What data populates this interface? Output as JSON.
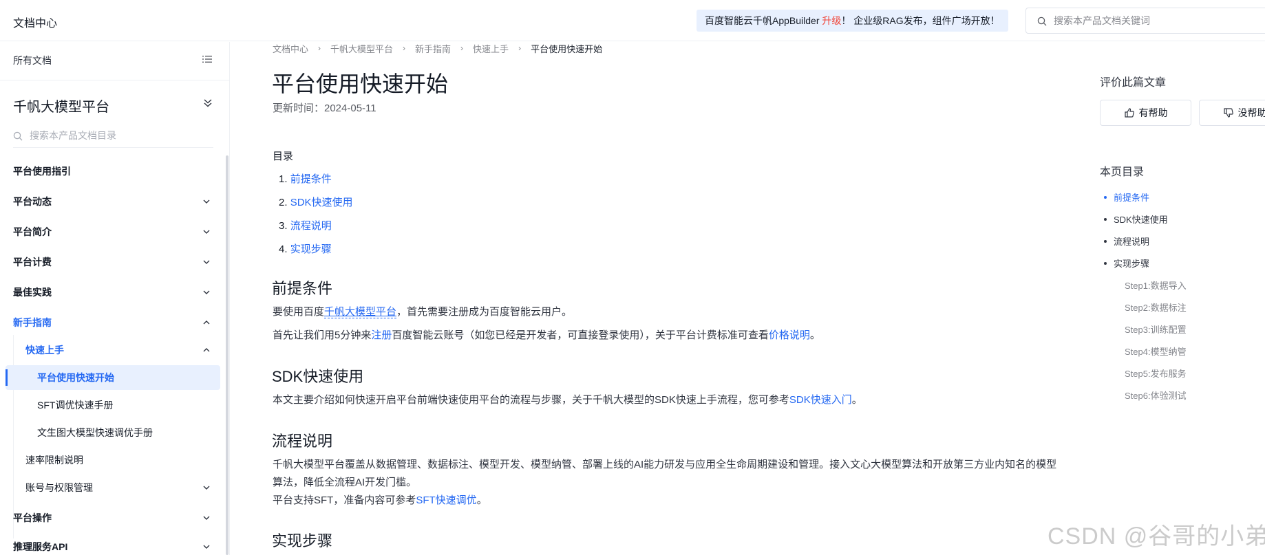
{
  "header": {
    "title": "文档中心",
    "banner": {
      "prefix": "百度智能云千帆AppBuilder ",
      "highlight": "升级",
      "suffix": "！ 企业级RAG发布，组件广场开放！"
    },
    "search_placeholder": "搜索本产品文档关键词"
  },
  "sidebar": {
    "all_docs": "所有文档",
    "product_title": "千帆大模型平台",
    "search_placeholder": "搜索本产品文档目录",
    "items": [
      {
        "label": "平台使用指引"
      },
      {
        "label": "平台动态"
      },
      {
        "label": "平台简介"
      },
      {
        "label": "平台计费"
      },
      {
        "label": "最佳实践"
      },
      {
        "label": "新手指南"
      },
      {
        "label": "快速上手"
      },
      {
        "label": "平台使用快速开始"
      },
      {
        "label": "SFT调优快速手册"
      },
      {
        "label": "文生图大模型快速调优手册"
      },
      {
        "label": "速率限制说明"
      },
      {
        "label": "账号与权限管理"
      },
      {
        "label": "平台操作"
      },
      {
        "label": "推理服务API"
      }
    ]
  },
  "breadcrumb": [
    "文档中心",
    "千帆大模型平台",
    "新手指南",
    "快速上手",
    "平台使用快速开始"
  ],
  "article": {
    "title": "平台使用快速开始",
    "updated": "更新时间：2024-05-11",
    "toc_label": "目录",
    "toc": [
      "前提条件",
      "SDK快速使用",
      "流程说明",
      "实现步骤"
    ],
    "sections": {
      "prereq": {
        "heading": "前提条件",
        "p1_before": "要使用百度",
        "p1_link": "千帆大模型平台",
        "p1_after": "，首先需要注册成为百度智能云用户。",
        "p2_before": "首先让我们用5分钟来",
        "p2_link": "注册",
        "p2_mid": "百度智能云账号（如您已经是开发者，可直接登录使用），关于平台计费标准可查看",
        "p2_link2": "价格说明",
        "p2_after": "。"
      },
      "sdk": {
        "heading": "SDK快速使用",
        "p_before": "本文主要介绍如何快速开启平台前端快速使用平台的流程与步骤，关于千帆大模型的SDK快速上手流程，您可参考",
        "p_link": "SDK快速入门",
        "p_after": "。"
      },
      "flow": {
        "heading": "流程说明",
        "p1": "千帆大模型平台覆盖从数据管理、数据标注、模型开发、模型纳管、部署上线的AI能力研发与应用全生命周期建设和管理。接入文心大模型算法和开放第三方业内知名的模型算法，降低全流程AI开发门槛。",
        "p2_before": "平台支持SFT，准备内容可参考",
        "p2_link": "SFT快速调优",
        "p2_after": "。"
      },
      "steps": {
        "heading": "实现步骤"
      }
    }
  },
  "rail": {
    "rate_title": "评价此篇文章",
    "helpful": "有帮助",
    "not_helpful": "没帮助",
    "page_toc_title": "本页目录",
    "page_toc": [
      "前提条件",
      "SDK快速使用",
      "流程说明",
      "实现步骤"
    ],
    "page_toc_sub": [
      "Step1:数据导入",
      "Step2:数据标注",
      "Step3:训练配置",
      "Step4:模型纳管",
      "Step5:发布服务",
      "Step6:体验测试"
    ]
  },
  "watermark": "CSDN @谷哥的小弟",
  "colors": {
    "accent": "#2468f2",
    "banner_bg": "#e8f0fe",
    "highlight": "#f04134"
  }
}
